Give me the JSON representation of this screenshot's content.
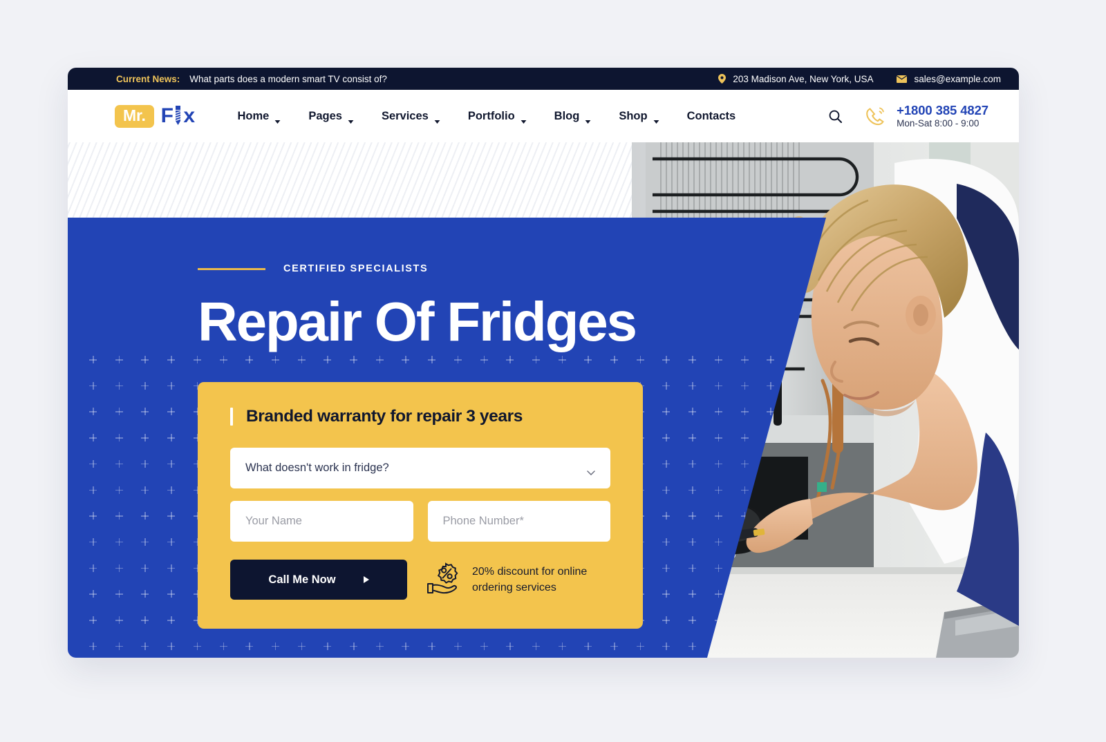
{
  "theme": {
    "page_bg": "#f1f2f6",
    "navy": "#0d1530",
    "blue": "#2244b5",
    "yellow": "#f3c44d",
    "gold": "#eec35a"
  },
  "topbar": {
    "news_label": "Current News:",
    "news_text": "What parts does a modern smart TV consist of?",
    "address_icon": "location-pin-icon",
    "address": "203 Madison Ave, New York, USA",
    "email_icon": "envelope-icon",
    "email": "sales@example.com"
  },
  "header": {
    "logo": {
      "badge": "Mr.",
      "word_start": "F",
      "word_end": "x",
      "screw_icon": "screw-icon"
    },
    "nav": [
      {
        "label": "Home",
        "has_dropdown": true
      },
      {
        "label": "Pages",
        "has_dropdown": true
      },
      {
        "label": "Services",
        "has_dropdown": true
      },
      {
        "label": "Portfolio",
        "has_dropdown": true
      },
      {
        "label": "Blog",
        "has_dropdown": true
      },
      {
        "label": "Shop",
        "has_dropdown": true
      },
      {
        "label": "Contacts",
        "has_dropdown": false
      }
    ],
    "search_icon": "search-icon",
    "phone_icon": "phone-ring-icon",
    "phone_number": "+1800 385 4827",
    "phone_hours": "Mon-Sat 8:00 - 9:00"
  },
  "hero": {
    "eyebrow": "CERTIFIED SPECIALISTS",
    "title": "Repair Of Fridges",
    "photo_alt": "technician repairing back of a refrigerator",
    "form": {
      "title": "Branded warranty for repair 3 years",
      "select_value": "What doesn't work in fridge?",
      "select_caret_icon": "chevron-down-icon",
      "name_placeholder": "Your Name",
      "phone_placeholder": "Phone Number*",
      "cta_label": "Call Me Now",
      "cta_arrow_icon": "play-arrow-icon",
      "discount_icon": "hand-percent-discount-icon",
      "discount_line1": "20% discount for online",
      "discount_line2": "ordering services"
    }
  }
}
